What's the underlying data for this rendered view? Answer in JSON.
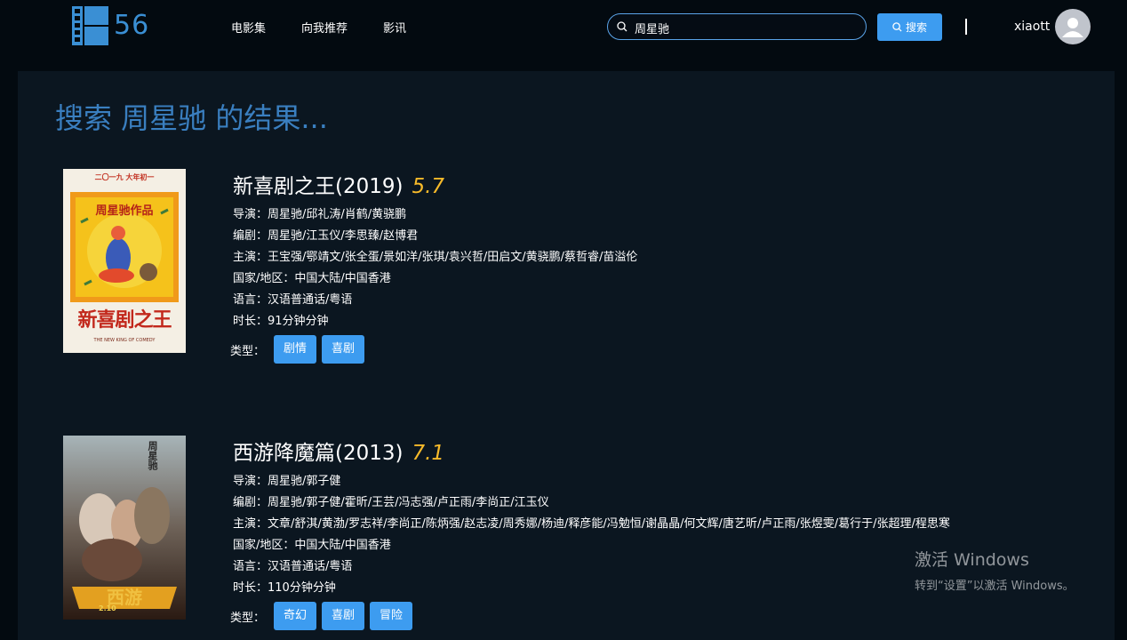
{
  "header": {
    "logo_text": "56",
    "nav": [
      "电影集",
      "向我推荐",
      "影讯"
    ],
    "search": {
      "value": "周星驰",
      "button_label": "搜索"
    },
    "username": "xiaott"
  },
  "main": {
    "result_title": "搜索 周星驰 的结果...",
    "movies": [
      {
        "title": "新喜剧之王(2019)",
        "rating": "5.7",
        "director": "导演：周星驰/邱礼涛/肖鹤/黄骁鹏",
        "writer": "编剧：周星驰/江玉仪/李思臻/赵博君",
        "cast": "主演：王宝强/鄂靖文/张全蛋/景如洋/张琪/袁兴哲/田启文/黄骁鹏/蔡哲睿/苗溢伦",
        "region": "国家/地区：中国大陆/中国香港",
        "language": "语言：汉语普通话/粤语",
        "duration": "时长：91分钟分钟",
        "genre_label": "类型：",
        "genres": [
          "剧情",
          "喜剧"
        ],
        "poster": {
          "top": "二〇一九 大年初一",
          "badge": "周星驰作品",
          "title": "新喜剧之王",
          "subtitle": "THE NEW KING OF COMEDY"
        }
      },
      {
        "title": "西游降魔篇(2013)",
        "rating": "7.1",
        "director": "导演：周星驰/郭子健",
        "writer": "编剧：周星驰/郭子健/霍昕/王芸/冯志强/卢正雨/李尚正/江玉仪",
        "cast": "主演：文章/舒淇/黄渤/罗志祥/李尚正/陈炳强/赵志凌/周秀娜/杨迪/释彦能/冯勉恒/谢晶晶/何文辉/唐艺昕/卢正雨/张煜雯/葛行于/张超理/程思寒",
        "region": "国家/地区：中国大陆/中国香港",
        "language": "语言：汉语普通话/粤语",
        "duration": "时长：110分钟分钟",
        "genre_label": "类型：",
        "genres": [
          "奇幻",
          "喜剧",
          "冒险"
        ],
        "poster": {
          "author": "周星驰",
          "title": "西游",
          "date": "2.10"
        }
      }
    ]
  },
  "watermark": {
    "line1": "激活 Windows",
    "line2": "转到“设置”以激活 Windows。"
  },
  "colors": {
    "accent": "#3d9cf0",
    "rating": "#f7ba2a",
    "title_blue": "#3a7fc0",
    "bg": "#030a10",
    "panel": "#0b1620"
  }
}
